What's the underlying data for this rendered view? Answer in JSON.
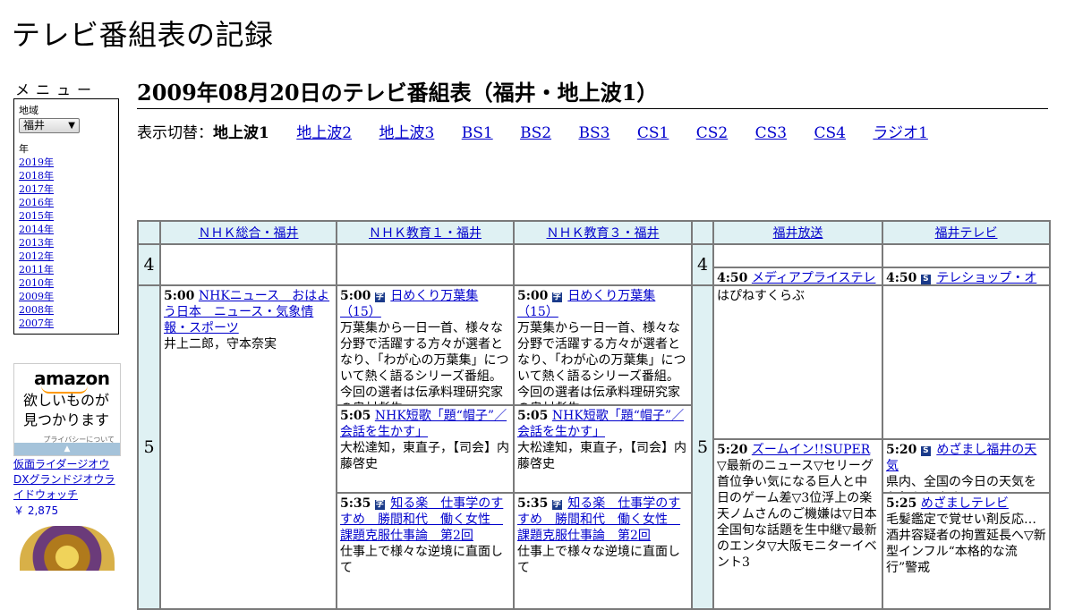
{
  "site": {
    "title": "テレビ番組表の記録"
  },
  "menu": {
    "label": "メニュー",
    "region_label": "地域",
    "region_value": "福井",
    "year_label": "年",
    "years": [
      "2019年",
      "2018年",
      "2017年",
      "2016年",
      "2015年",
      "2014年",
      "2013年",
      "2012年",
      "2011年",
      "2010年",
      "2009年",
      "2008年",
      "2007年"
    ]
  },
  "ad": {
    "logo": "amazon",
    "tagline_1": "欲しいものが",
    "tagline_2": "見つかります",
    "privacy": "プライバシーについて",
    "product_name": "仮面ライダージオウ DXグランドジオウライドウォッチ",
    "product_price": "￥ 2,875"
  },
  "page": {
    "title": "2009年08月20日のテレビ番組表（福井・地上波1）"
  },
  "switcher": {
    "label": "表示切替：",
    "current": "地上波1",
    "links": [
      "地上波2",
      "地上波3",
      "BS1",
      "BS2",
      "BS3",
      "CS1",
      "CS2",
      "CS3",
      "CS4",
      "ラジオ1"
    ]
  },
  "channels": [
    "ＮＨＫ総合・福井",
    "ＮＨＫ教育１・福井",
    "ＮＨＫ教育３・福井",
    "福井放送",
    "福井テレビ"
  ],
  "hours": [
    "4",
    "5"
  ],
  "programs": {
    "nhk_sogo": [
      {
        "time": "5:00",
        "title": "NHKニュース　おはよう日本　ニュース・気象情報・スポーツ",
        "desc": "井上二郎，守本奈実"
      }
    ],
    "nhk_edu1": [
      {
        "time": "5:00",
        "icon": "字",
        "title": "日めくり万葉集（15）",
        "desc": "万葉集から一日一首、様々な分野で活躍する方々が選者となり、「わが心の万葉集」について熱く語るシリーズ番組。今回の選者は伝承料理研究家の奥村彪生。"
      },
      {
        "time": "5:05",
        "title": "NHK短歌「題“帽子”／会話を生かす」",
        "desc": "大松達知，東直子，【司会】内藤啓史"
      },
      {
        "time": "5:35",
        "icon": "字",
        "title": "知る楽　仕事学のすすめ　勝間和代　働く女性　課題克服仕事論　第2回",
        "desc": "仕事上で様々な逆境に直面して"
      }
    ],
    "nhk_edu3": [
      {
        "time": "5:00",
        "icon": "字",
        "title": "日めくり万葉集（15）",
        "desc": "万葉集から一日一首、様々な分野で活躍する方々が選者となり、「わが心の万葉集」について熱く語るシリーズ番組。今回の選者は伝承料理研究家の奥村彪生。"
      },
      {
        "time": "5:05",
        "title": "NHK短歌「題“帽子”／会話を生かす」",
        "desc": "大松達知，東直子，【司会】内藤啓史"
      },
      {
        "time": "5:35",
        "icon": "字",
        "title": "知る楽　仕事学のすすめ　勝間和代　働く女性　課題克服仕事論　第2回",
        "desc": "仕事上で様々な逆境に直面して"
      }
    ],
    "fukui_hoso": [
      {
        "time": "4:50",
        "title": "メディアプライステレビショッピング",
        "desc": "はぴねすくらぶ"
      },
      {
        "time": "5:20",
        "title": "ズームイン!!SUPER",
        "desc": "▽最新のニュース▽セリーグ首位争い気になる巨人と中日のゲーム差▽3位浮上の楽天ノムさんのご機嫌は▽日本全国旬な話題を生中継▽最新のエンタ▽大阪モニターイベント3"
      }
    ],
    "fukui_tv": [
      {
        "time": "4:50",
        "icon": "S",
        "title": "テレショップ・オークローンワールドテレショップ",
        "desc": ""
      },
      {
        "time": "5:20",
        "icon": "S",
        "title": "めざまし福井の天気",
        "desc": "県内、全国の今日の天気をお伝えします。"
      },
      {
        "time": "5:25",
        "title": "めざましテレビ",
        "desc": "毛髪鑑定で覚せい剤反応…酒井容疑者の拘置延長へ▽新型インフル“本格的な流行”警戒"
      }
    ]
  }
}
